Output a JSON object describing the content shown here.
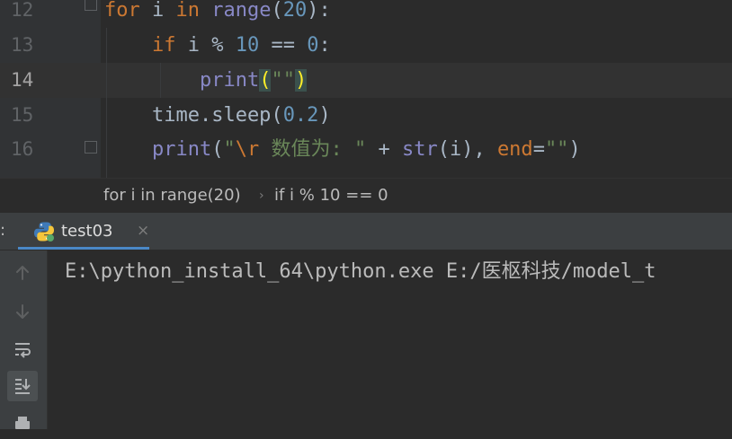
{
  "editor": {
    "lines": [
      {
        "number": "12",
        "tokens": [
          {
            "t": "for",
            "c": "kw"
          },
          {
            "t": " i ",
            "c": "op"
          },
          {
            "t": "in",
            "c": "kw"
          },
          {
            "t": " ",
            "c": "op"
          },
          {
            "t": "range",
            "c": "fn"
          },
          {
            "t": "(",
            "c": "op"
          },
          {
            "t": "20",
            "c": "num"
          },
          {
            "t": "):",
            "c": "op"
          }
        ]
      },
      {
        "number": "13",
        "tokens": [
          {
            "t": "    ",
            "c": "op"
          },
          {
            "t": "if",
            "c": "kw"
          },
          {
            "t": " i % ",
            "c": "op"
          },
          {
            "t": "10",
            "c": "num"
          },
          {
            "t": " == ",
            "c": "op"
          },
          {
            "t": "0",
            "c": "num"
          },
          {
            "t": ":",
            "c": "op"
          }
        ]
      },
      {
        "number": "14",
        "tokens": [
          {
            "t": "        ",
            "c": "op"
          },
          {
            "t": "print",
            "c": "fn"
          },
          {
            "t": "(",
            "c": "brace-match"
          },
          {
            "t": "\"\"",
            "c": "str"
          },
          {
            "t": ")",
            "c": "brace-match"
          }
        ]
      },
      {
        "number": "15",
        "tokens": [
          {
            "t": "    time.sleep(",
            "c": "op"
          },
          {
            "t": "0.2",
            "c": "num"
          },
          {
            "t": ")",
            "c": "op"
          }
        ]
      },
      {
        "number": "16",
        "tokens": [
          {
            "t": "    ",
            "c": "op"
          },
          {
            "t": "print",
            "c": "fn"
          },
          {
            "t": "(",
            "c": "op"
          },
          {
            "t": "\"",
            "c": "str"
          },
          {
            "t": "\\r",
            "c": "esc"
          },
          {
            "t": " 数值为: \"",
            "c": "str"
          },
          {
            "t": " + ",
            "c": "op"
          },
          {
            "t": "str",
            "c": "fn"
          },
          {
            "t": "(i), ",
            "c": "op"
          },
          {
            "t": "end",
            "c": "kw"
          },
          {
            "t": "=",
            "c": "op"
          },
          {
            "t": "\"\"",
            "c": "str"
          },
          {
            "t": ")",
            "c": "op"
          }
        ]
      }
    ]
  },
  "breadcrumb": {
    "items": [
      "for i in range(20)",
      "if i % 10 == 0"
    ],
    "separator": "›"
  },
  "run_panel": {
    "header_label": ":",
    "tab_label": "test03",
    "tab_close": "×",
    "toolbar_icons": [
      "arrow-up-icon",
      "arrow-down-icon",
      "soft-wrap-icon",
      "scroll-to-end-icon",
      "print-icon"
    ],
    "console_text": "E:\\python_install_64\\python.exe E:/医枢科技/model_t"
  },
  "colors": {
    "keyword": "#cc7832",
    "number": "#6897bb",
    "builtin": "#8888c6",
    "string": "#6a8759",
    "text": "#a9b7c6",
    "tab_accent": "#4a88c7"
  }
}
